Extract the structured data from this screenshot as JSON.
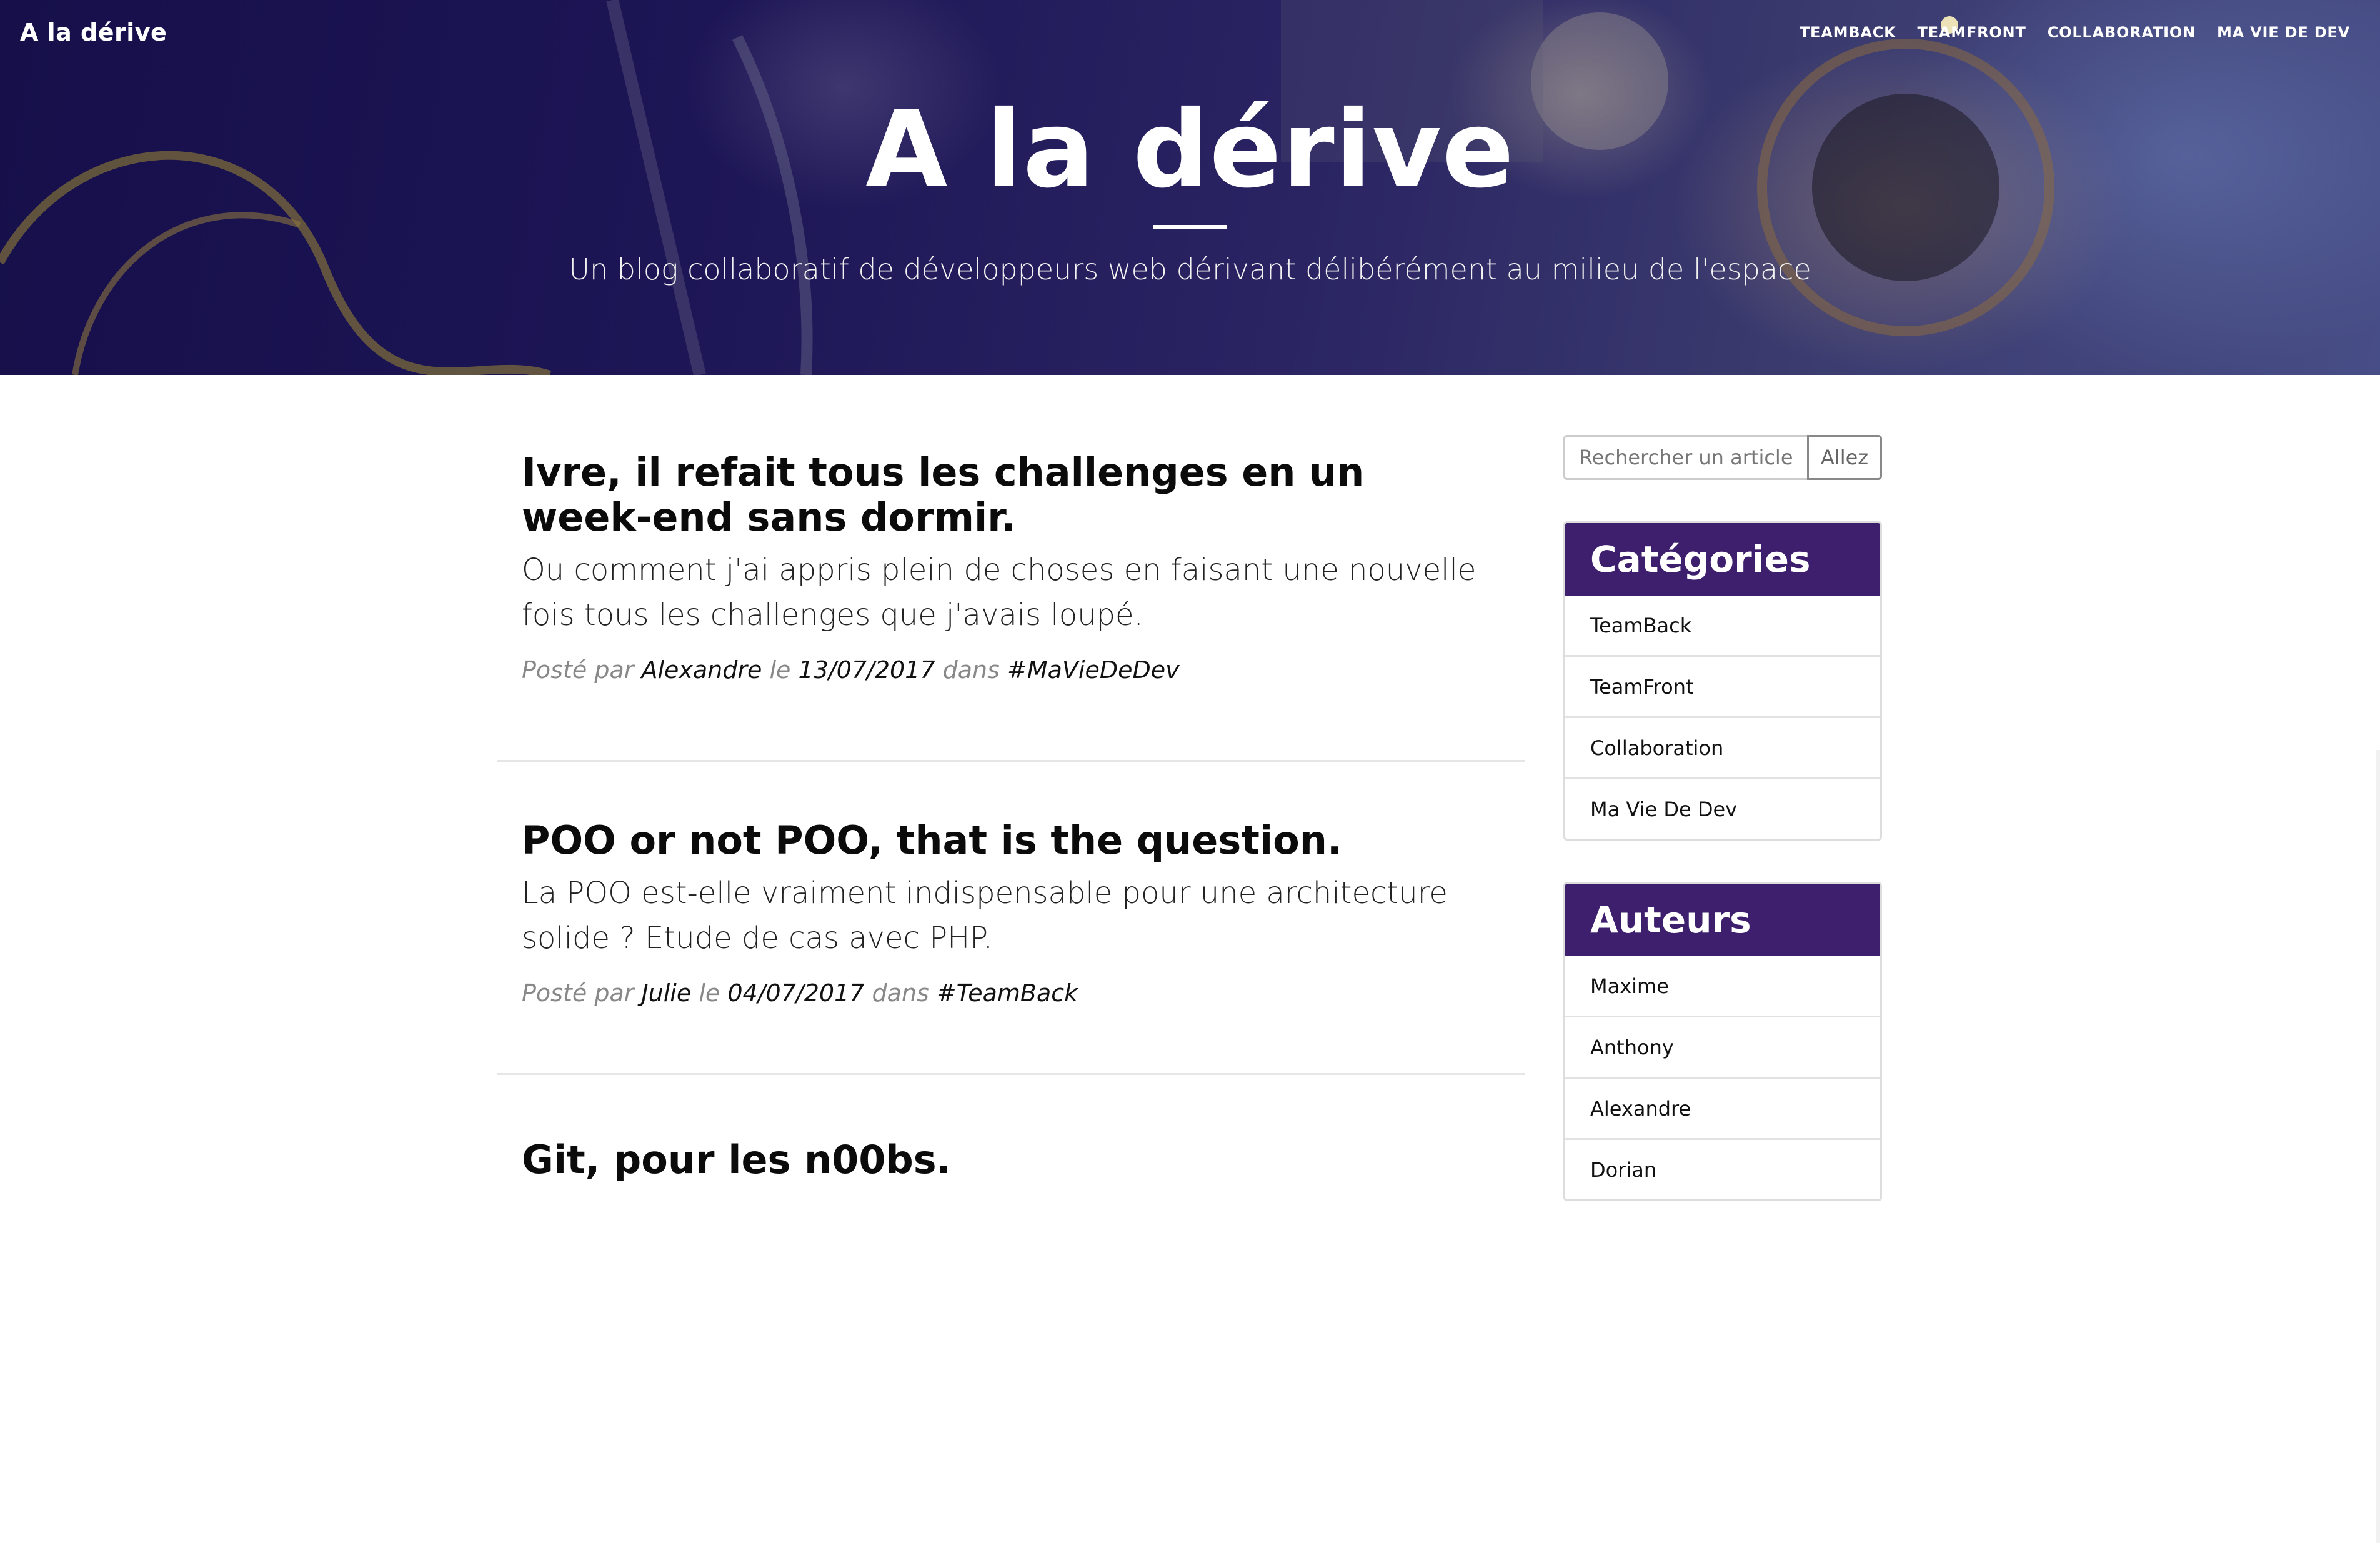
{
  "nav": {
    "brand": "A la dérive",
    "links": [
      "TEAMBACK",
      "TEAMFRONT",
      "COLLABORATION",
      "MA VIE DE DEV"
    ]
  },
  "header": {
    "title": "A la dérive",
    "subtitle": "Un blog collaboratif de développeurs web dérivant délibérément au milieu de l'espace"
  },
  "posts": [
    {
      "title": "Ivre, il refait tous les challenges en un week-end sans dormir.",
      "subtitle": "Ou comment j'ai appris plein de choses en faisant une nouvelle fois tous les challenges que j'avais loupé.",
      "posted_by": "Posté par",
      "author": "Alexandre",
      "on": "le",
      "date": "13/07/2017",
      "in": "dans",
      "category": "#MaVieDeDev"
    },
    {
      "title": "POO or not POO, that is the question.",
      "subtitle": "La POO est-elle vraiment indispensable pour une architecture solide ? Etude de cas avec PHP.",
      "posted_by": "Posté par",
      "author": "Julie",
      "on": "le",
      "date": "04/07/2017",
      "in": "dans",
      "category": "#TeamBack"
    },
    {
      "title": "Git, pour les n00bs."
    }
  ],
  "sidebar": {
    "search": {
      "placeholder": "Rechercher un article...",
      "button": "Allez"
    },
    "categories": {
      "title": "Catégories",
      "items": [
        "TeamBack",
        "TeamFront",
        "Collaboration",
        "Ma Vie De Dev"
      ]
    },
    "authors": {
      "title": "Auteurs",
      "items": [
        "Maxime",
        "Anthony",
        "Alexandre",
        "Dorian"
      ]
    }
  },
  "colors": {
    "accent": "#3d1f6e",
    "header_bg": "#1d1656"
  }
}
